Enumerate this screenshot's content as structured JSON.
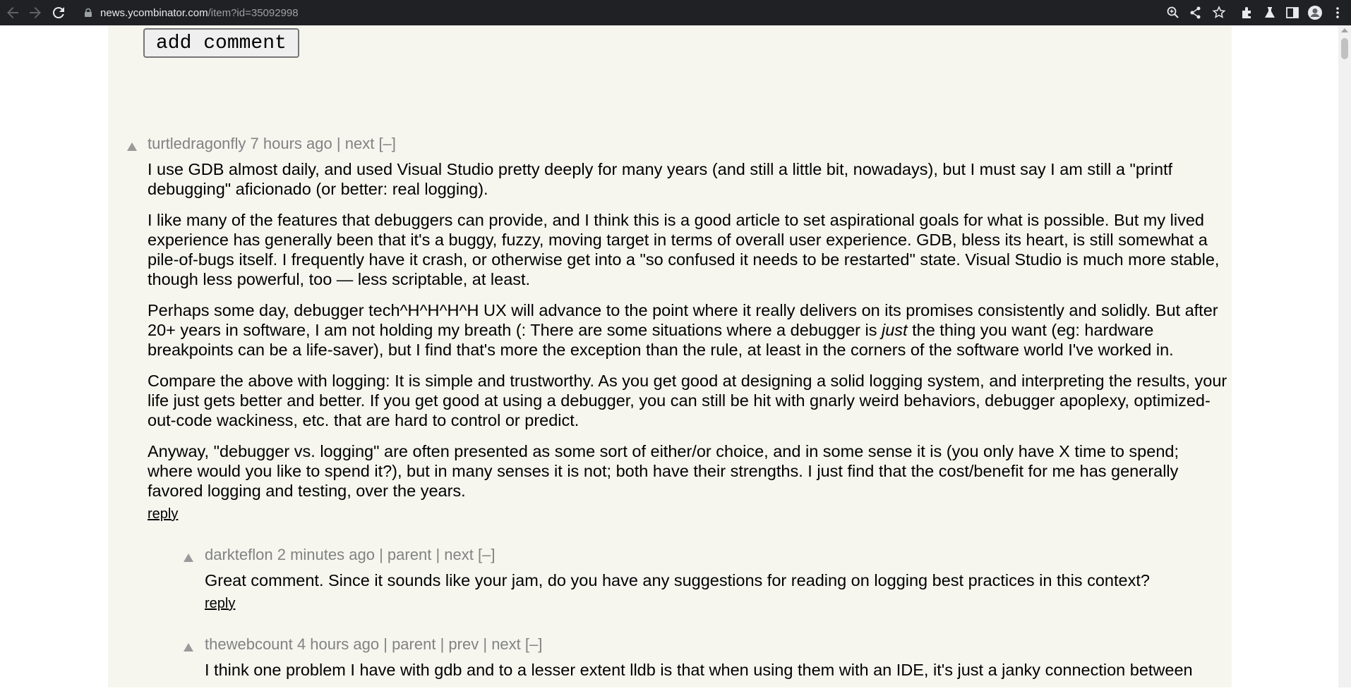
{
  "browser": {
    "url_domain": "news.ycombinator.com",
    "url_path": "/item?id=35092998",
    "icons": [
      "back-icon",
      "forward-icon",
      "reload-icon",
      "lock-icon",
      "zoom-icon",
      "share-icon",
      "star-icon",
      "extensions-icon",
      "labs-icon",
      "sidepanel-icon",
      "profile-icon",
      "menu-icon"
    ]
  },
  "page": {
    "add_comment_label": "add comment",
    "colors": {
      "hn_bg": "#f6f6ef",
      "meta": "#828282"
    }
  },
  "comments": [
    {
      "user": "turtledragonfly",
      "age": "7 hours ago",
      "sep1": "|",
      "link1": "next",
      "toggle": "[–]",
      "p1": "I use GDB almost daily, and used Visual Studio pretty deeply for many years (and still a little bit, nowadays), but I must say I am still a \"printf debugging\" aficionado (or better: real logging).",
      "p2": "I like many of the features that debuggers can provide, and I think this is a good article to set aspirational goals for what is possible. But my lived experience has generally been that it's a buggy, fuzzy, moving target in terms of overall user experience. GDB, bless its heart, is still somewhat a pile-of-bugs itself. I frequently have it crash, or otherwise get into a \"so confused it needs to be restarted\" state. Visual Studio is much more stable, though less powerful, too — less scriptable, at least.",
      "p3a": "Perhaps some day, debugger tech^H^H^H^H UX will advance to the point where it really delivers on its promises consistently and solidly. But after 20+ years in software, I am not holding my breath (: There are some situations where a debugger is ",
      "p3em": "just",
      "p3b": " the thing you want (eg: hardware breakpoints can be a life-saver), but I find that's more the exception than the rule, at least in the corners of the software world I've worked in.",
      "p4": "Compare the above with logging: It is simple and trustworthy. As you get good at designing a solid logging system, and interpreting the results, your life just gets better and better. If you get good at using a debugger, you can still be hit with gnarly weird behaviors, debugger apoplexy, optimized-out-code wackiness, etc. that are hard to control or predict.",
      "p5": "Anyway, \"debugger vs. logging\" are often presented as some sort of either/or choice, and in some sense it is (you only have X time to spend; where would you like to spend it?), but in many senses it is not; both have their strengths. I just find that the cost/benefit for me has generally favored logging and testing, over the years.",
      "reply": "reply"
    },
    {
      "user": "darkteflon",
      "age": "2 minutes ago",
      "sep": "|",
      "parent": "parent",
      "next": "next",
      "toggle": "[–]",
      "p1": "Great comment. Since it sounds like your jam, do you have any suggestions for reading on logging best practices in this context?",
      "reply": "reply"
    },
    {
      "user": "thewebcount",
      "age": "4 hours ago",
      "sep": "|",
      "parent": "parent",
      "prev": "prev",
      "next": "next",
      "toggle": "[–]",
      "p1": "I think one problem I have with gdb and to a lesser extent lldb is that when using them with an IDE, it's just a janky connection between"
    }
  ]
}
